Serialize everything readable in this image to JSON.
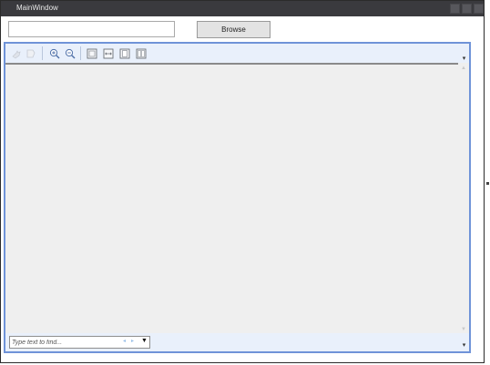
{
  "window": {
    "title": "MainWindow"
  },
  "top": {
    "path_value": "",
    "browse_label": "Browse"
  },
  "toolbar": {
    "items": [
      {
        "icon": "hand-icon",
        "enabled": false
      },
      {
        "icon": "select-icon",
        "enabled": false
      },
      {
        "icon": "zoom-in-icon",
        "enabled": true
      },
      {
        "icon": "zoom-out-icon",
        "enabled": true
      },
      {
        "icon": "fit-page-icon",
        "enabled": true
      },
      {
        "icon": "fit-width-icon",
        "enabled": true
      },
      {
        "icon": "single-page-icon",
        "enabled": true
      },
      {
        "icon": "two-page-icon",
        "enabled": true
      }
    ],
    "overflow_glyph": "▾"
  },
  "findbar": {
    "placeholder": "Type text to find...",
    "prev_glyph": "◂",
    "next_glyph": "▸",
    "dropdown_glyph": "▼",
    "overflow_glyph": "▾"
  },
  "colors": {
    "titlebar": "#3a3a3e",
    "viewer_border": "#6f93d8",
    "toolbar_bg": "#e9f0fb",
    "document_bg": "#efefef"
  }
}
